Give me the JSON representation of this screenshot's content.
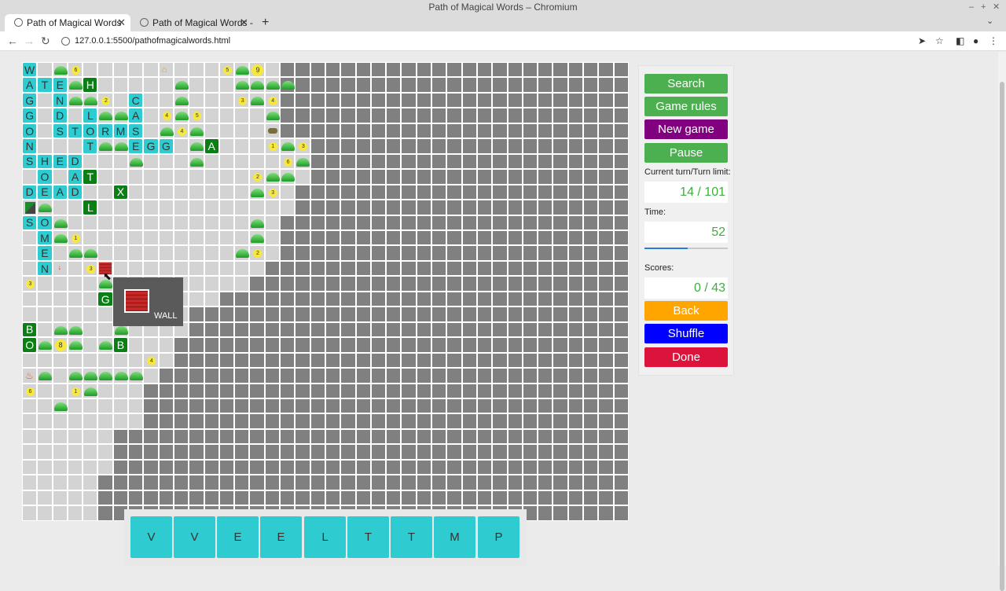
{
  "window": {
    "title": "Path of Magical Words – Chromium"
  },
  "tabs": [
    {
      "label": "Path of Magical Words",
      "active": true
    },
    {
      "label": "Path of Magical Words -",
      "active": false
    }
  ],
  "toolbar": {
    "url": "127.0.0.1:5500/pathofmagicalwords.html"
  },
  "board": {
    "cols": 40,
    "rows": 30,
    "open_area_row_widths": [
      17,
      17,
      17,
      17,
      17,
      19,
      19,
      19,
      18,
      18,
      17,
      17,
      17,
      16,
      15,
      13,
      11,
      11,
      10,
      10,
      9,
      8,
      8,
      8,
      6,
      6,
      6,
      5,
      5,
      5
    ],
    "cells": [
      {
        "r": 0,
        "c": 0,
        "t": "letter",
        "v": "W"
      },
      {
        "r": 0,
        "c": 2,
        "t": "bush"
      },
      {
        "r": 0,
        "c": 3,
        "t": "coin",
        "v": "6"
      },
      {
        "r": 0,
        "c": 9,
        "t": "hut"
      },
      {
        "r": 0,
        "c": 13,
        "t": "coin",
        "v": "5"
      },
      {
        "r": 0,
        "c": 14,
        "t": "bush"
      },
      {
        "r": 0,
        "c": 15,
        "t": "coin",
        "v": "9",
        "big": true
      },
      {
        "r": 1,
        "c": 0,
        "t": "letter",
        "v": "A"
      },
      {
        "r": 1,
        "c": 1,
        "t": "letter",
        "v": "T"
      },
      {
        "r": 1,
        "c": 2,
        "t": "letter",
        "v": "E"
      },
      {
        "r": 1,
        "c": 3,
        "t": "bush"
      },
      {
        "r": 1,
        "c": 4,
        "t": "dark",
        "v": "H"
      },
      {
        "r": 1,
        "c": 10,
        "t": "bush"
      },
      {
        "r": 1,
        "c": 14,
        "t": "bush"
      },
      {
        "r": 1,
        "c": 15,
        "t": "bush"
      },
      {
        "r": 1,
        "c": 16,
        "t": "bush"
      },
      {
        "r": 1,
        "c": 17,
        "t": "bush"
      },
      {
        "r": 2,
        "c": 0,
        "t": "letter",
        "v": "G"
      },
      {
        "r": 2,
        "c": 2,
        "t": "letter",
        "v": "N"
      },
      {
        "r": 2,
        "c": 3,
        "t": "bush"
      },
      {
        "r": 2,
        "c": 4,
        "t": "bush"
      },
      {
        "r": 2,
        "c": 5,
        "t": "coin",
        "v": "2"
      },
      {
        "r": 2,
        "c": 7,
        "t": "letter",
        "v": "C"
      },
      {
        "r": 2,
        "c": 10,
        "t": "bush"
      },
      {
        "r": 2,
        "c": 14,
        "t": "coin",
        "v": "3"
      },
      {
        "r": 2,
        "c": 15,
        "t": "bush"
      },
      {
        "r": 2,
        "c": 16,
        "t": "coin",
        "v": "4"
      },
      {
        "r": 3,
        "c": 0,
        "t": "letter",
        "v": "G"
      },
      {
        "r": 3,
        "c": 2,
        "t": "letter",
        "v": "D"
      },
      {
        "r": 3,
        "c": 4,
        "t": "letter",
        "v": "L"
      },
      {
        "r": 3,
        "c": 5,
        "t": "bush"
      },
      {
        "r": 3,
        "c": 6,
        "t": "bush"
      },
      {
        "r": 3,
        "c": 7,
        "t": "letter",
        "v": "A"
      },
      {
        "r": 3,
        "c": 9,
        "t": "coin",
        "v": "4"
      },
      {
        "r": 3,
        "c": 10,
        "t": "bush"
      },
      {
        "r": 3,
        "c": 11,
        "t": "coin",
        "v": "5"
      },
      {
        "r": 3,
        "c": 16,
        "t": "bush"
      },
      {
        "r": 4,
        "c": 0,
        "t": "letter",
        "v": "O"
      },
      {
        "r": 4,
        "c": 2,
        "t": "letter",
        "v": "S"
      },
      {
        "r": 4,
        "c": 3,
        "t": "letter",
        "v": "T"
      },
      {
        "r": 4,
        "c": 4,
        "t": "letter",
        "v": "O"
      },
      {
        "r": 4,
        "c": 5,
        "t": "letter",
        "v": "R"
      },
      {
        "r": 4,
        "c": 6,
        "t": "letter",
        "v": "M"
      },
      {
        "r": 4,
        "c": 7,
        "t": "letter",
        "v": "S"
      },
      {
        "r": 4,
        "c": 9,
        "t": "bush"
      },
      {
        "r": 4,
        "c": 10,
        "t": "coin",
        "v": "4"
      },
      {
        "r": 4,
        "c": 11,
        "t": "bush"
      },
      {
        "r": 4,
        "c": 16,
        "t": "obj"
      },
      {
        "r": 5,
        "c": 0,
        "t": "letter",
        "v": "N"
      },
      {
        "r": 5,
        "c": 4,
        "t": "letter",
        "v": "T"
      },
      {
        "r": 5,
        "c": 5,
        "t": "bush"
      },
      {
        "r": 5,
        "c": 6,
        "t": "bush"
      },
      {
        "r": 5,
        "c": 7,
        "t": "letter",
        "v": "E"
      },
      {
        "r": 5,
        "c": 8,
        "t": "letter",
        "v": "G"
      },
      {
        "r": 5,
        "c": 9,
        "t": "letter",
        "v": "G"
      },
      {
        "r": 5,
        "c": 11,
        "t": "bush"
      },
      {
        "r": 5,
        "c": 12,
        "t": "dark",
        "v": "A"
      },
      {
        "r": 5,
        "c": 16,
        "t": "coin",
        "v": "1"
      },
      {
        "r": 5,
        "c": 17,
        "t": "bush"
      },
      {
        "r": 5,
        "c": 18,
        "t": "coin",
        "v": "3"
      },
      {
        "r": 6,
        "c": 0,
        "t": "letter",
        "v": "S"
      },
      {
        "r": 6,
        "c": 1,
        "t": "letter",
        "v": "H"
      },
      {
        "r": 6,
        "c": 2,
        "t": "letter",
        "v": "E"
      },
      {
        "r": 6,
        "c": 3,
        "t": "letter",
        "v": "D"
      },
      {
        "r": 6,
        "c": 7,
        "t": "bush"
      },
      {
        "r": 6,
        "c": 11,
        "t": "bush"
      },
      {
        "r": 6,
        "c": 17,
        "t": "coin",
        "v": "6"
      },
      {
        "r": 6,
        "c": 18,
        "t": "bush"
      },
      {
        "r": 7,
        "c": 1,
        "t": "letter",
        "v": "O"
      },
      {
        "r": 7,
        "c": 3,
        "t": "letter",
        "v": "A"
      },
      {
        "r": 7,
        "c": 4,
        "t": "dark",
        "v": "T"
      },
      {
        "r": 7,
        "c": 15,
        "t": "coin",
        "v": "2"
      },
      {
        "r": 7,
        "c": 16,
        "t": "bush"
      },
      {
        "r": 7,
        "c": 17,
        "t": "bush"
      },
      {
        "r": 8,
        "c": 0,
        "t": "letter",
        "v": "D"
      },
      {
        "r": 8,
        "c": 1,
        "t": "letter",
        "v": "E"
      },
      {
        "r": 8,
        "c": 2,
        "t": "letter",
        "v": "A"
      },
      {
        "r": 8,
        "c": 3,
        "t": "letter",
        "v": "D"
      },
      {
        "r": 8,
        "c": 6,
        "t": "dark",
        "v": "X"
      },
      {
        "r": 8,
        "c": 15,
        "t": "bush"
      },
      {
        "r": 8,
        "c": 16,
        "t": "coin",
        "v": "3"
      },
      {
        "r": 9,
        "c": 0,
        "t": "gem"
      },
      {
        "r": 9,
        "c": 1,
        "t": "bush"
      },
      {
        "r": 9,
        "c": 4,
        "t": "dark",
        "v": "L"
      },
      {
        "r": 10,
        "c": 0,
        "t": "letter",
        "v": "S"
      },
      {
        "r": 10,
        "c": 1,
        "t": "letter",
        "v": "O"
      },
      {
        "r": 10,
        "c": 2,
        "t": "bush"
      },
      {
        "r": 10,
        "c": 15,
        "t": "bush"
      },
      {
        "r": 11,
        "c": 1,
        "t": "letter",
        "v": "M"
      },
      {
        "r": 11,
        "c": 2,
        "t": "bush"
      },
      {
        "r": 11,
        "c": 3,
        "t": "coin",
        "v": "1"
      },
      {
        "r": 11,
        "c": 15,
        "t": "bush"
      },
      {
        "r": 12,
        "c": 1,
        "t": "letter",
        "v": "E"
      },
      {
        "r": 12,
        "c": 3,
        "t": "bush"
      },
      {
        "r": 12,
        "c": 4,
        "t": "bush"
      },
      {
        "r": 12,
        "c": 14,
        "t": "bush"
      },
      {
        "r": 12,
        "c": 15,
        "t": "coin",
        "v": "2"
      },
      {
        "r": 13,
        "c": 1,
        "t": "letter",
        "v": "N"
      },
      {
        "r": 13,
        "c": 2,
        "t": "arrow"
      },
      {
        "r": 13,
        "c": 4,
        "t": "coin",
        "v": "3"
      },
      {
        "r": 13,
        "c": 5,
        "t": "brick"
      },
      {
        "r": 14,
        "c": 0,
        "t": "coin",
        "v": "3"
      },
      {
        "r": 14,
        "c": 5,
        "t": "bush"
      },
      {
        "r": 15,
        "c": 5,
        "t": "dark",
        "v": "G"
      },
      {
        "r": 17,
        "c": 0,
        "t": "dark",
        "v": "B"
      },
      {
        "r": 17,
        "c": 2,
        "t": "bush"
      },
      {
        "r": 17,
        "c": 3,
        "t": "bush"
      },
      {
        "r": 17,
        "c": 6,
        "t": "bush"
      },
      {
        "r": 18,
        "c": 0,
        "t": "dark",
        "v": "O"
      },
      {
        "r": 18,
        "c": 1,
        "t": "bush"
      },
      {
        "r": 18,
        "c": 2,
        "t": "coin",
        "v": "8",
        "big": true
      },
      {
        "r": 18,
        "c": 3,
        "t": "bush"
      },
      {
        "r": 18,
        "c": 5,
        "t": "bush"
      },
      {
        "r": 18,
        "c": 6,
        "t": "dark",
        "v": "B"
      },
      {
        "r": 19,
        "c": 8,
        "t": "coin",
        "v": "4"
      },
      {
        "r": 20,
        "c": 0,
        "t": "fire"
      },
      {
        "r": 20,
        "c": 1,
        "t": "bush"
      },
      {
        "r": 20,
        "c": 3,
        "t": "bush"
      },
      {
        "r": 20,
        "c": 4,
        "t": "bush"
      },
      {
        "r": 20,
        "c": 5,
        "t": "bush"
      },
      {
        "r": 20,
        "c": 6,
        "t": "bush"
      },
      {
        "r": 20,
        "c": 7,
        "t": "bush"
      },
      {
        "r": 21,
        "c": 0,
        "t": "coin",
        "v": "6"
      },
      {
        "r": 21,
        "c": 3,
        "t": "coin",
        "v": "1"
      },
      {
        "r": 21,
        "c": 4,
        "t": "bush"
      },
      {
        "r": 22,
        "c": 2,
        "t": "bush"
      }
    ]
  },
  "tooltip": {
    "label": "WALL"
  },
  "rack": {
    "tiles": [
      "V",
      "V",
      "E",
      "E",
      "L",
      "T",
      "T",
      "M",
      "P"
    ]
  },
  "panel": {
    "search_label": "Search",
    "rules_label": "Game rules",
    "new_game_label": "New game",
    "pause_label": "Pause",
    "turn_caption": "Current turn/Turn limit:",
    "turn_value": "14 / 101",
    "time_caption": "Time:",
    "time_value": "52",
    "time_progress": 0.52,
    "scores_caption": "Scores:",
    "scores_value": "0 / 43",
    "back_label": "Back",
    "shuffle_label": "Shuffle",
    "done_label": "Done"
  },
  "colors": {
    "green_button": "#4caf50",
    "purple_button": "#800080",
    "orange_button": "#ffa500",
    "blue_button": "#0000ff",
    "red_button": "#dc143c",
    "tile_cyan": "#2ecbd0",
    "tile_dark_green": "#0b7e16",
    "wall_gray": "#808080",
    "open_gray": "#d3d3d3"
  }
}
